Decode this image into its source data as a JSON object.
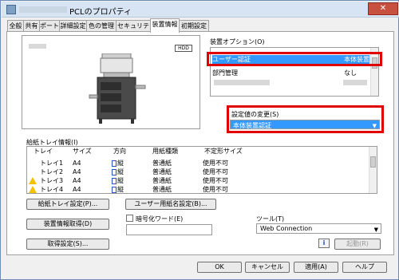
{
  "window": {
    "title": "PCLのプロパティ",
    "close_glyph": "✕"
  },
  "tabs": [
    "全般",
    "共有",
    "ポート",
    "詳細設定",
    "色の管理",
    "セキュリティ",
    "装置情報",
    "初期設定"
  ],
  "preview": {
    "hdd_label": "HDD"
  },
  "options": {
    "label": "装置オプション(O)",
    "rows": [
      {
        "name": "ユーザー認証",
        "value": "本体装置"
      },
      {
        "name": "部門管理",
        "value": "なし"
      }
    ]
  },
  "change": {
    "label": "設定値の変更(S)",
    "value": "本体装置認証"
  },
  "tray": {
    "label": "給紙トレイ情報(I)",
    "headers": [
      "トレイ",
      "サイズ",
      "方向",
      "用紙種類",
      "不定形サイズ"
    ],
    "rows": [
      {
        "tray": "トレイ1",
        "size": "A4",
        "dir": "縦",
        "type": "普通紙",
        "custom": "使用不可"
      },
      {
        "tray": "トレイ2",
        "size": "A4",
        "dir": "縦",
        "type": "普通紙",
        "custom": "使用不可"
      },
      {
        "tray": "トレイ3",
        "size": "A4",
        "dir": "縦",
        "type": "普通紙",
        "custom": "使用不可"
      },
      {
        "tray": "トレイ4",
        "size": "A4",
        "dir": "縦",
        "type": "普通紙",
        "custom": "使用不可"
      }
    ]
  },
  "buttons": {
    "tray_settings": "給紙トレイ設定(P)...",
    "user_paper": "ユーザー用紙名設定(B)...",
    "device_info": "装置情報取得(D)",
    "acquire": "取得設定(S)...",
    "start": "起動(R)",
    "ok": "OK",
    "cancel": "キャンセル",
    "apply": "適用(A)",
    "help": "ヘルプ"
  },
  "encrypt": {
    "label": "暗号化ワード(E)"
  },
  "tool": {
    "label": "ツール(T)",
    "value": "Web Connection"
  }
}
